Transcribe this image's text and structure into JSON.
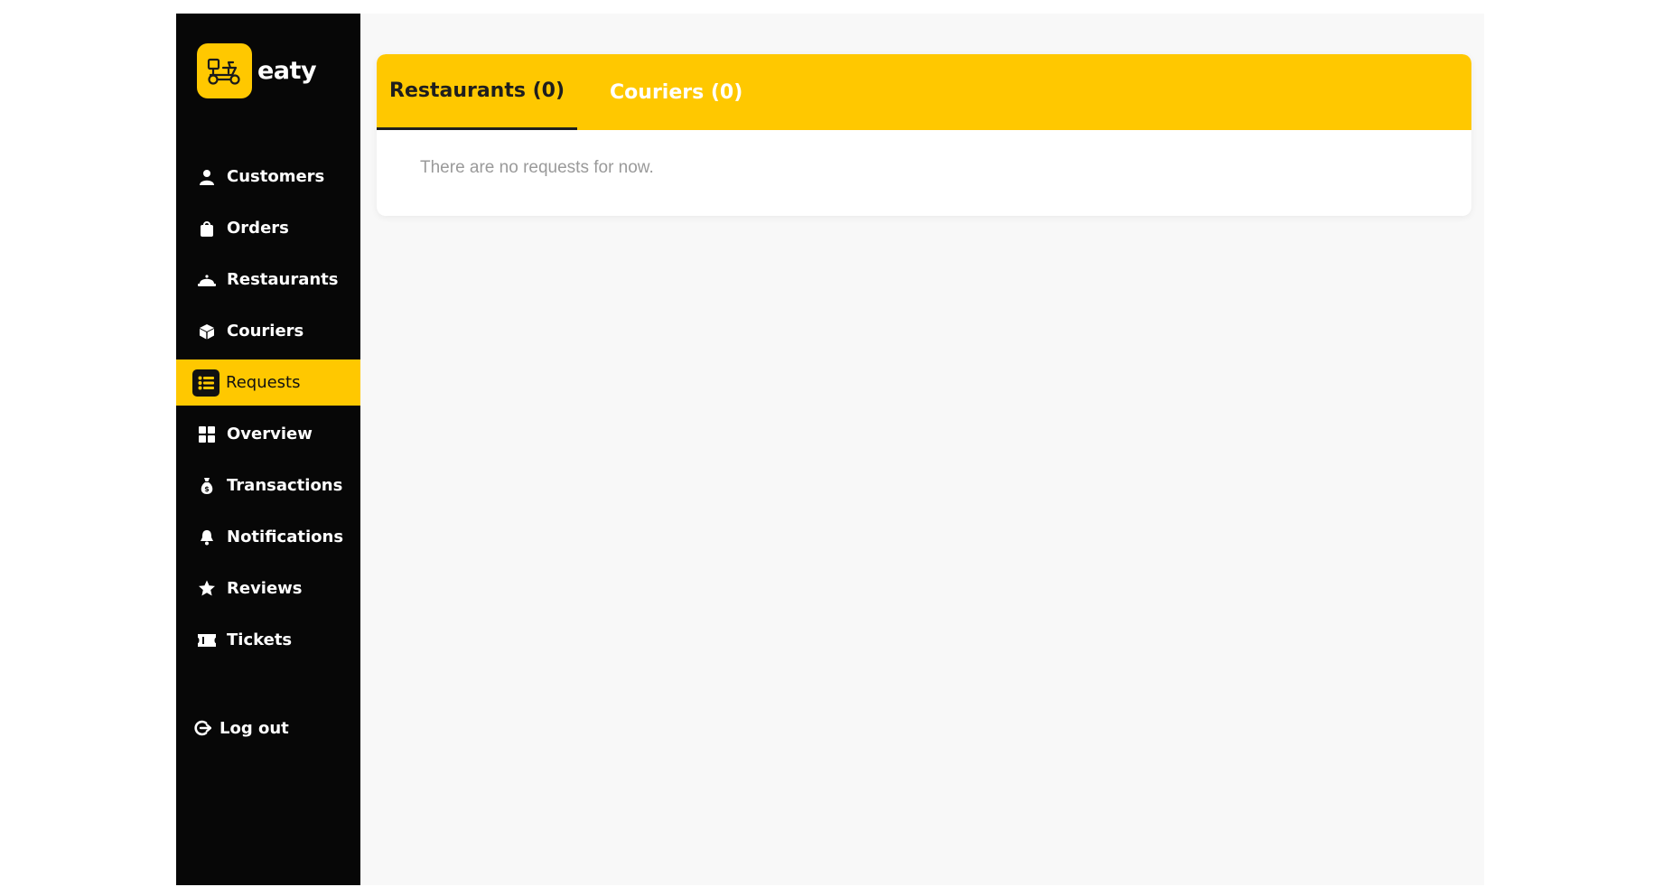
{
  "brand": {
    "name": "eaty",
    "accent": "#ffc800",
    "sidebar_bg": "#070707",
    "logo_icon": "scooter-icon"
  },
  "sidebar": {
    "items": [
      {
        "label": "Customers",
        "icon": "user-icon"
      },
      {
        "label": "Orders",
        "icon": "shopping-bag-icon"
      },
      {
        "label": "Restaurants",
        "icon": "cloche-icon"
      },
      {
        "label": "Couriers",
        "icon": "box-icon"
      },
      {
        "label": "Requests",
        "icon": "list-icon",
        "active": true
      },
      {
        "label": "Overview",
        "icon": "grid-icon"
      },
      {
        "label": "Transactions",
        "icon": "money-bag-icon"
      },
      {
        "label": "Notifications",
        "icon": "bell-icon"
      },
      {
        "label": "Reviews",
        "icon": "star-icon"
      },
      {
        "label": "Tickets",
        "icon": "ticket-icon"
      }
    ],
    "logout": {
      "label": "Log out",
      "icon": "logout-icon"
    }
  },
  "main": {
    "tabs": [
      {
        "label": "Restaurants (0)",
        "active": true
      },
      {
        "label": "Couriers (0)",
        "active": false
      }
    ],
    "empty_message": "There are no requests for now."
  }
}
